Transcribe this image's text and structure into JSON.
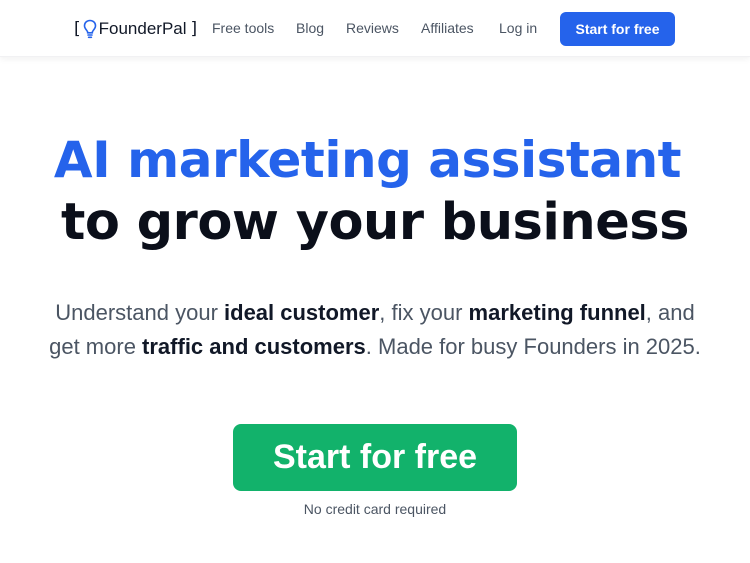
{
  "nav": {
    "logo_text": "FounderPal",
    "logo_bracket_left": "[",
    "logo_bracket_right": "]",
    "logo_icon": "lightbulb-icon",
    "links": [
      {
        "label": "Free tools"
      },
      {
        "label": "Blog"
      },
      {
        "label": "Reviews"
      },
      {
        "label": "Affiliates"
      },
      {
        "label": "Log in"
      }
    ],
    "cta_label": "Start for free"
  },
  "hero": {
    "headline_accent": "AI marketing assistant",
    "headline_rest": "to grow your business",
    "subtitle_line1": {
      "t1": "Understand your ",
      "b1": "ideal customer",
      "t2": ", fix your ",
      "b2": "marketing funnel",
      "t3": ", and"
    },
    "subtitle_line2": {
      "t1": "get more ",
      "b1": "traffic and customers",
      "t2": ". Made for busy Founders in 2025."
    },
    "cta_label": "Start for free",
    "cta_note": "No credit card required"
  },
  "colors": {
    "accent_blue": "#2563eb",
    "cta_green": "#12b26b",
    "heading_dark": "#0b0f1a",
    "muted_text": "#4b5563"
  }
}
